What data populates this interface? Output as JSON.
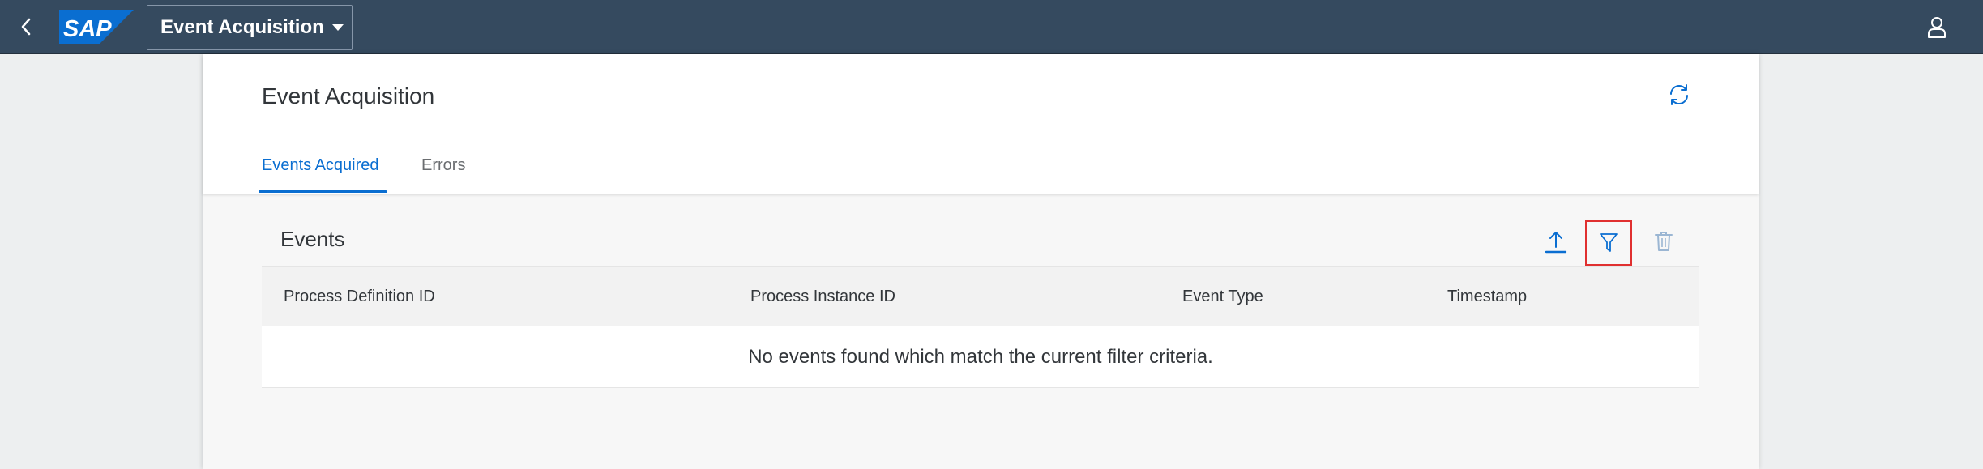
{
  "shell": {
    "logo_text": "SAP",
    "app_title": "Event Acquisition",
    "colors": {
      "bar": "#354a5f",
      "logo_blue": "#0a6ed1"
    },
    "icons": {
      "back": "chevron-left-icon",
      "user": "user-icon"
    }
  },
  "page": {
    "title": "Event Acquisition",
    "refresh_icon": "refresh-icon",
    "tabs": [
      {
        "label": "Events Acquired",
        "selected": true
      },
      {
        "label": "Errors",
        "selected": false
      }
    ]
  },
  "events": {
    "title": "Events",
    "toolbar": {
      "upload_icon": "upload-icon",
      "filter_icon": "filter-icon",
      "delete_icon": "delete-icon"
    },
    "columns": [
      "Process Definition ID",
      "Process Instance ID",
      "Event Type",
      "Timestamp"
    ],
    "rows": [],
    "no_data_text": "No events found which match the current filter criteria."
  }
}
